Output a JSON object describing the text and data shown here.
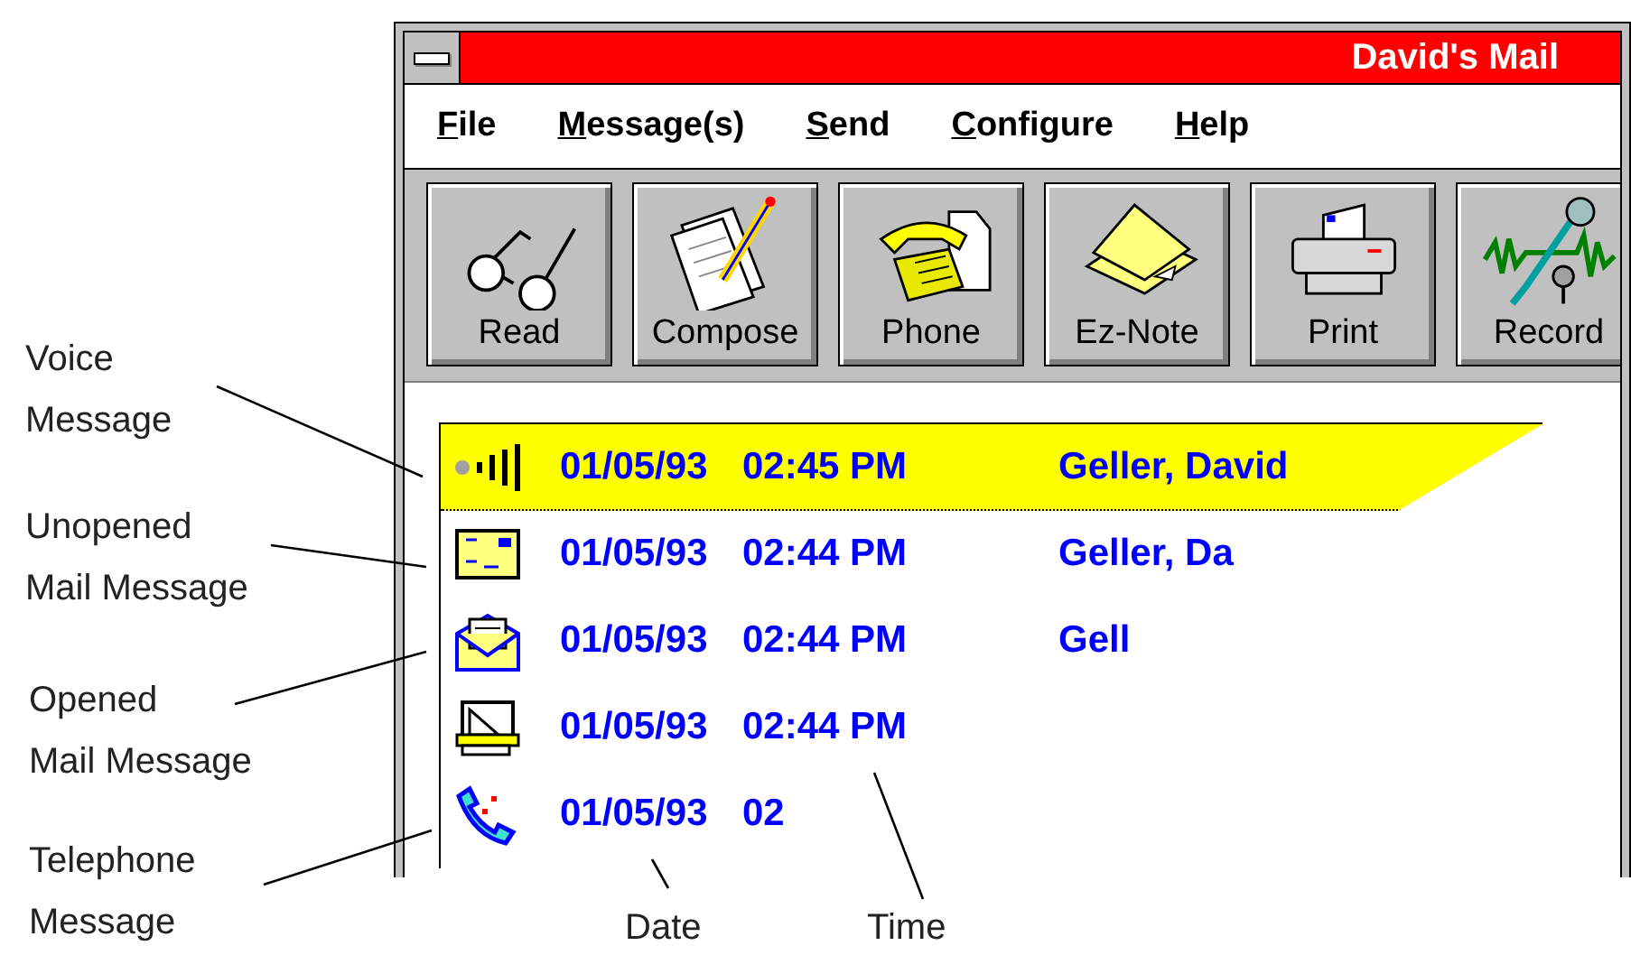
{
  "window": {
    "title": "David's Mail"
  },
  "menu": [
    {
      "label": "File",
      "first_letter_underlined": true
    },
    {
      "label": "Message(s)",
      "first_letter_underlined": true
    },
    {
      "label": "Send",
      "first_letter_underlined": true
    },
    {
      "label": "Configure",
      "first_letter_underlined": true
    },
    {
      "label": "Help",
      "first_letter_underlined": true
    }
  ],
  "toolbar": [
    {
      "label": "Read",
      "kind": "glasses"
    },
    {
      "label": "Compose",
      "kind": "compose"
    },
    {
      "label": "Phone",
      "kind": "phone"
    },
    {
      "label": "Ez-Note",
      "kind": "note"
    },
    {
      "label": "Print",
      "kind": "printer"
    },
    {
      "label": "Record",
      "kind": "microphone"
    }
  ],
  "messages": [
    {
      "kind": "voice",
      "date": "01/05/93",
      "time": "02:45 PM",
      "sender": "Geller, David",
      "selected": true
    },
    {
      "kind": "unopened",
      "date": "01/05/93",
      "time": "02:44 PM",
      "sender": "Geller, Da",
      "selected": false
    },
    {
      "kind": "opened",
      "date": "01/05/93",
      "time": "02:44 PM",
      "sender": "Gell",
      "selected": false
    },
    {
      "kind": "fax",
      "date": "01/05/93",
      "time": "02:44 PM",
      "selected": false
    },
    {
      "kind": "telephone",
      "date": "01/05/93",
      "time": "02",
      "selected": false
    }
  ],
  "callouts": [
    {
      "lines": [
        "Voice",
        "Message"
      ]
    },
    {
      "lines": [
        "Unopened",
        "Mail Message"
      ]
    },
    {
      "lines": [
        "Opened",
        "Mail Message"
      ]
    },
    {
      "lines": [
        "Telephone",
        "Message"
      ]
    },
    {
      "lines": [
        "Date"
      ]
    },
    {
      "lines": [
        "Time"
      ]
    }
  ]
}
